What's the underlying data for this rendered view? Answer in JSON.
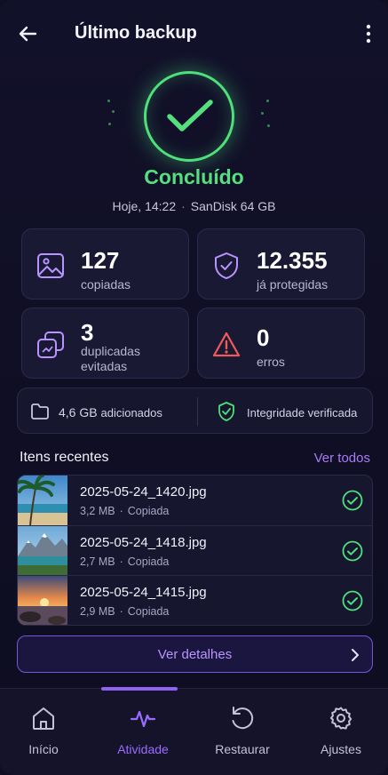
{
  "header": {
    "title": "Último backup"
  },
  "hero": {
    "status": "Concluído",
    "time": "Hoje, 14:22",
    "device": "SanDisk 64 GB"
  },
  "stats": [
    {
      "value": "127",
      "label": "copiadas"
    },
    {
      "value": "12.355",
      "label": "já protegidas"
    },
    {
      "value": "3",
      "label": "duplicadas evitadas"
    },
    {
      "value": "0",
      "label": "erros"
    }
  ],
  "info": {
    "added_value": "4,6 GB",
    "added_label": "adicionados",
    "integrity": "Integridade verificada"
  },
  "recent": {
    "title": "Itens recentes",
    "link": "Ver todos",
    "items": [
      {
        "name": "2025-05-24_1420.jpg",
        "size": "3,2 MB",
        "status": "Copiada"
      },
      {
        "name": "2025-05-24_1418.jpg",
        "size": "2,7 MB",
        "status": "Copiada"
      },
      {
        "name": "2025-05-24_1415.jpg",
        "size": "2,9 MB",
        "status": "Copiada"
      }
    ]
  },
  "details_button": "Ver detalhes",
  "nav": [
    {
      "label": "Início",
      "icon": "home-icon"
    },
    {
      "label": "Atividade",
      "icon": "activity-icon",
      "active": true
    },
    {
      "label": "Restaurar",
      "icon": "restore-icon"
    },
    {
      "label": "Ajustes",
      "icon": "gear-icon"
    }
  ],
  "colors": {
    "success": "#4ee07a",
    "accent": "#8f62f2",
    "error": "#ef5b5b",
    "background": "#0f0e22"
  }
}
